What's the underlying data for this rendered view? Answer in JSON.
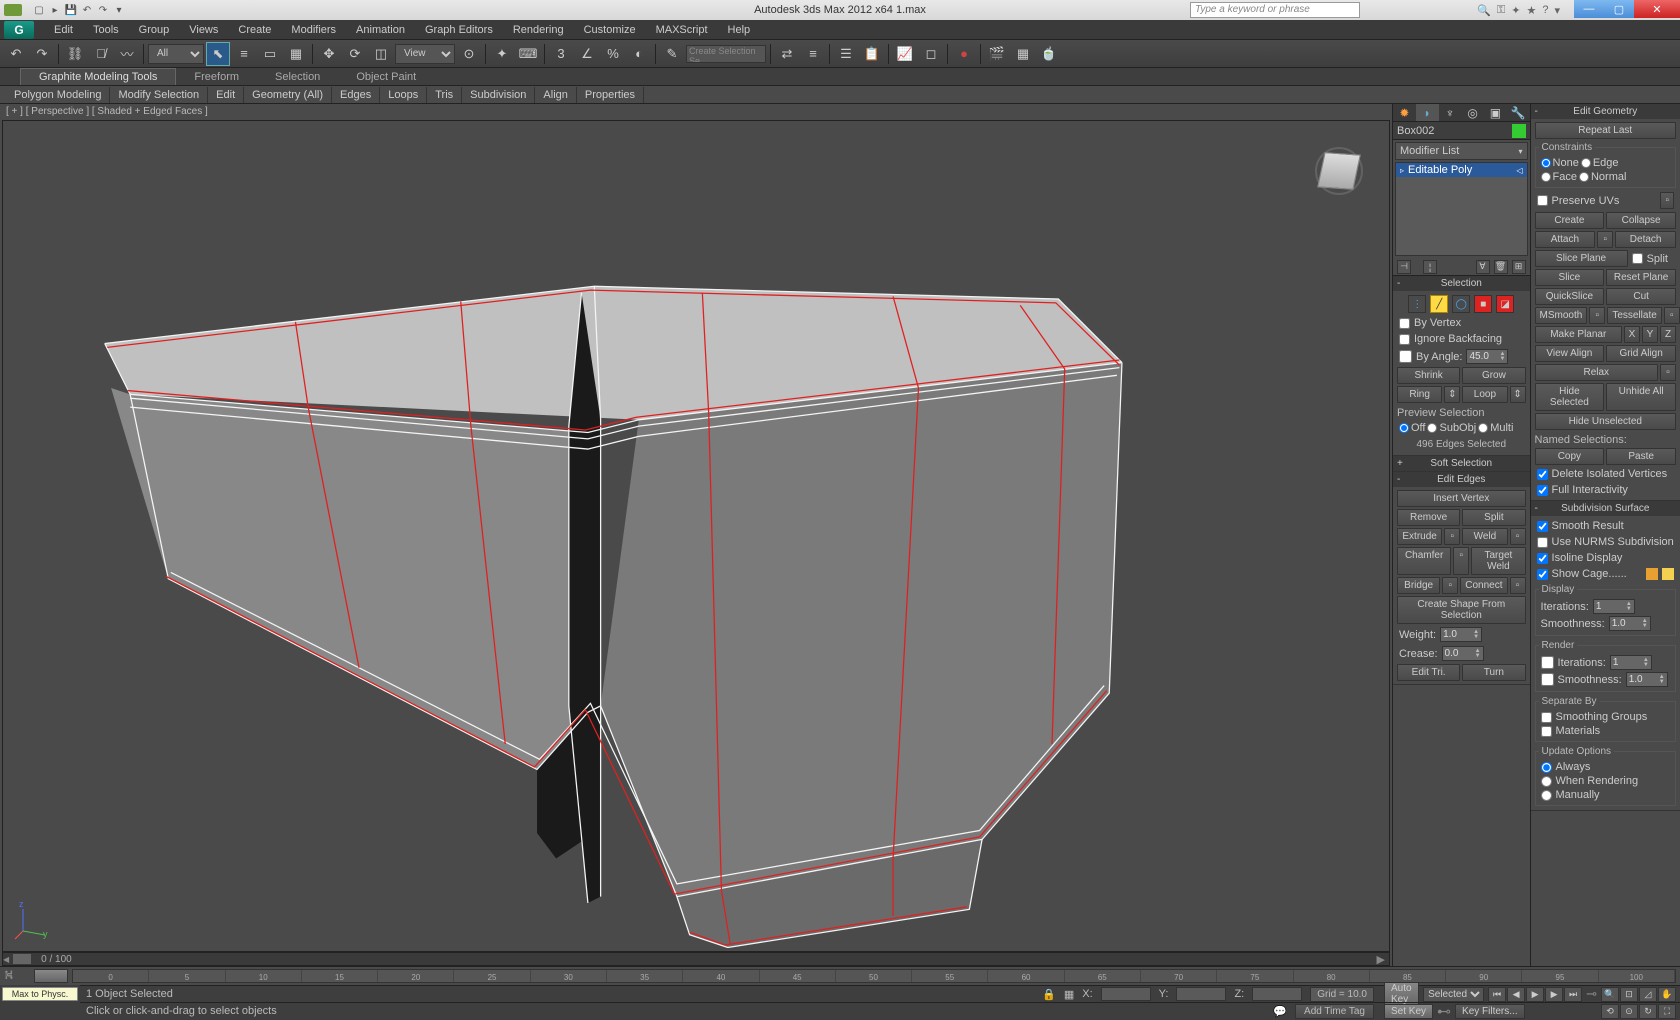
{
  "title": "Autodesk 3ds Max 2012 x64    1.max",
  "search_placeholder": "Type a keyword or phrase",
  "menu": [
    "Edit",
    "Tools",
    "Group",
    "Views",
    "Create",
    "Modifiers",
    "Animation",
    "Graph Editors",
    "Rendering",
    "Customize",
    "MAXScript",
    "Help"
  ],
  "toolbar": {
    "sel_filter": "All",
    "refcoord": "View",
    "named_sel": "Create Selection Se"
  },
  "ribbon": {
    "tabs": [
      "Graphite Modeling Tools",
      "Freeform",
      "Selection",
      "Object Paint"
    ],
    "sub": [
      "Polygon Modeling",
      "Modify Selection",
      "Edit",
      "Geometry (All)",
      "Edges",
      "Loops",
      "Tris",
      "Subdivision",
      "Align",
      "Properties"
    ]
  },
  "viewport": {
    "label": "[ + ] [ Perspective ] [ Shaded + Edged Faces ]",
    "scroll_pos": "0 / 100",
    "timeline_ticks": [
      "0",
      "5",
      "10",
      "15",
      "20",
      "25",
      "30",
      "35",
      "40",
      "45",
      "50",
      "55",
      "60",
      "65",
      "70",
      "75",
      "80",
      "85",
      "90",
      "95",
      "100"
    ]
  },
  "object": {
    "name": "Box002",
    "modifier_list": "Modifier List",
    "stack_item": "Editable Poly"
  },
  "selection": {
    "title": "Selection",
    "by_vertex": "By Vertex",
    "ignore_bf": "Ignore Backfacing",
    "by_angle": "By Angle:",
    "angle_val": "45.0",
    "shrink": "Shrink",
    "grow": "Grow",
    "ring": "Ring",
    "loop": "Loop",
    "preview": "Preview Selection",
    "off": "Off",
    "subobj": "SubObj",
    "multi": "Multi",
    "count": "496 Edges Selected"
  },
  "soft_sel": "Soft Selection",
  "edit_edges": {
    "title": "Edit Edges",
    "insert_vertex": "Insert Vertex",
    "remove": "Remove",
    "split": "Split",
    "extrude": "Extrude",
    "weld": "Weld",
    "chamfer": "Chamfer",
    "target_weld": "Target Weld",
    "bridge": "Bridge",
    "connect": "Connect",
    "create_shape": "Create Shape From Selection",
    "weight": "Weight:",
    "weight_val": "1.0",
    "crease": "Crease:",
    "crease_val": "0.0",
    "edit_tri": "Edit Tri.",
    "turn": "Turn"
  },
  "edit_geom": {
    "title": "Edit Geometry",
    "repeat": "Repeat Last",
    "constraints": "Constraints",
    "none": "None",
    "edge": "Edge",
    "face": "Face",
    "normal": "Normal",
    "preserve_uv": "Preserve UVs",
    "create": "Create",
    "collapse": "Collapse",
    "attach": "Attach",
    "detach": "Detach",
    "slice_plane": "Slice Plane",
    "split": "Split",
    "slice": "Slice",
    "reset_plane": "Reset Plane",
    "quickslice": "QuickSlice",
    "cut": "Cut",
    "msmooth": "MSmooth",
    "tessellate": "Tessellate",
    "make_planar": "Make Planar",
    "x": "X",
    "y": "Y",
    "z": "Z",
    "view_align": "View Align",
    "grid_align": "Grid Align",
    "relax": "Relax",
    "hide_sel": "Hide Selected",
    "unhide": "Unhide All",
    "hide_unsel": "Hide Unselected",
    "named_sel": "Named Selections:",
    "copy": "Copy",
    "paste": "Paste",
    "del_iso": "Delete Isolated Vertices",
    "full_int": "Full Interactivity"
  },
  "subdiv": {
    "title": "Subdivision Surface",
    "smooth": "Smooth Result",
    "nurms": "Use NURMS Subdivision",
    "isoline": "Isoline Display",
    "showcage": "Show Cage......",
    "display": "Display",
    "iterations": "Iterations:",
    "iter_val": "1",
    "smoothness": "Smoothness:",
    "smooth_val": "1.0",
    "render": "Render",
    "r_iter_val": "1",
    "r_smooth_val": "1.0",
    "separate": "Separate By",
    "smgrp": "Smoothing Groups",
    "materials": "Materials",
    "update": "Update Options",
    "always": "Always",
    "when_render": "When Rendering",
    "manually": "Manually"
  },
  "status": {
    "sel": "1 Object Selected",
    "prompt": "Click or click-and-drag to select objects",
    "x": "X:",
    "y": "Y:",
    "z": "Z:",
    "grid": "Grid = 10.0",
    "auto_key": "Auto Key",
    "set_key": "Set Key",
    "key_mode": "Selected",
    "key_filters": "Key Filters...",
    "add_time_tag": "Add Time Tag",
    "max_physc": "Max to Physc."
  }
}
